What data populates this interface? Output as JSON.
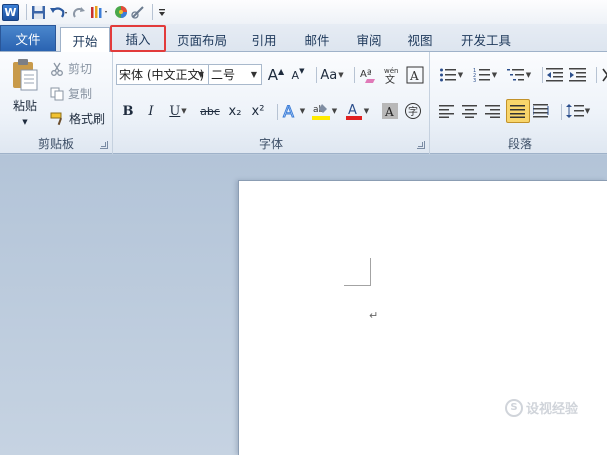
{
  "qat": {
    "app_icon": "word-logo-icon",
    "logo_letter": "W",
    "items": [
      "save-icon",
      "undo-icon",
      "redo-icon",
      "format-painter-icon",
      "color-icon",
      "brush-icon",
      "customize-icon"
    ]
  },
  "tabs": {
    "file": "文件",
    "home": "开始",
    "insert": "插入",
    "layout": "页面布局",
    "references": "引用",
    "mailings": "邮件",
    "review": "审阅",
    "view": "视图",
    "developer": "开发工具"
  },
  "clipboard": {
    "paste": "粘贴",
    "cut": "剪切",
    "copy": "复制",
    "format_painter": "格式刷",
    "label": "剪贴板"
  },
  "font": {
    "name": "宋体 (中文正文)",
    "size": "二号",
    "label": "字体",
    "grow": "A",
    "shrink": "A",
    "case": "Aa",
    "bold": "B",
    "italic": "I",
    "underline": "U",
    "strike": "abc",
    "subscript": "x₂",
    "superscript": "x²",
    "highlight_color": "#ffeb00",
    "font_color": "#e02020"
  },
  "paragraph": {
    "label": "段落"
  },
  "document": {
    "paragraph_mark": "↵"
  },
  "watermark": {
    "text": "设视经验"
  },
  "colors": {
    "file_tab": "#2a63b1",
    "highlight_box": "#e23b3b",
    "ribbon_bg": "#eef3f9",
    "doc_bg": "#b9c9db",
    "justify_active": "#f8d56b"
  }
}
